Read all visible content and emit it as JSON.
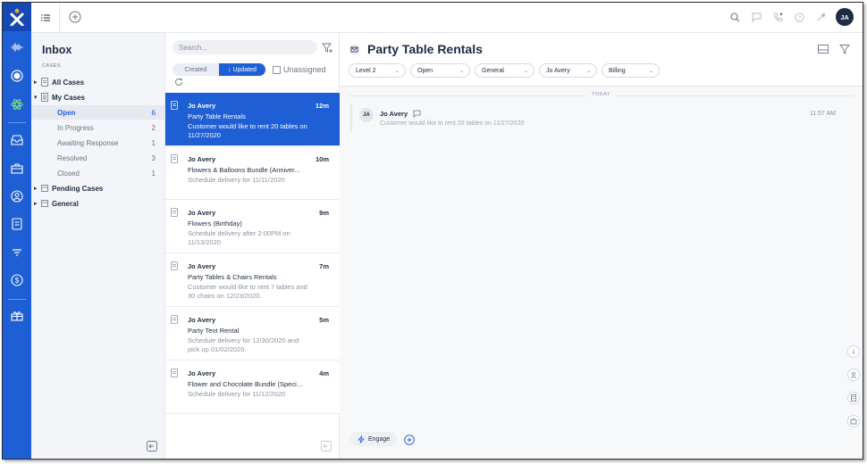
{
  "brand": {
    "accent": "#1f5fd6",
    "rail_dark": "#1548b3",
    "logo_letter": "x"
  },
  "topbar": {
    "icons": [
      "list-icon",
      "add-circle-icon",
      "search-icon",
      "chat-icon",
      "phone-icon",
      "help-icon",
      "tools-icon"
    ],
    "user_initials": "JA"
  },
  "rail": {
    "icons": [
      "waveform-icon",
      "record-icon",
      "atom-icon",
      "inbox-icon",
      "briefcase-icon",
      "contact-icon",
      "document-icon",
      "filter-icon",
      "dollar-icon",
      "gift-icon"
    ]
  },
  "sidebar": {
    "title": "Inbox",
    "caption": "CASES",
    "all_cases": "All Cases",
    "my_cases": "My Cases",
    "sub_items": [
      {
        "label": "Open",
        "count": "6"
      },
      {
        "label": "In Progress",
        "count": "2"
      },
      {
        "label": "Awaiting Response",
        "count": "1"
      },
      {
        "label": "Resolved",
        "count": "3"
      },
      {
        "label": "Closed",
        "count": "1"
      }
    ],
    "pending_cases": "Pending Cases",
    "general": "General"
  },
  "caselist": {
    "search_placeholder": "Search...",
    "tab_created": "Created",
    "tab_updated": "↓ Updated",
    "unassigned": "Unassigned",
    "cases": [
      {
        "who": "Jo Avery",
        "age": "12m",
        "subject": "Party Table Rentals",
        "preview": "Customer would like to rent 20 tables on 11/27/2020",
        "selected": true
      },
      {
        "who": "Jo Avery",
        "age": "10m",
        "subject": "Flowers & Balloons Bundle (Anniver...",
        "preview": "Schedule delivery for 11/11/2020",
        "selected": false
      },
      {
        "who": "Jo Avery",
        "age": "9m",
        "subject": "Flowers (Birthday)",
        "preview": "Schedule delivery after 2:00PM on 11/13/2020",
        "selected": false
      },
      {
        "who": "Jo Avery",
        "age": "7m",
        "subject": "Party Tables & Chairs Rentals",
        "preview": "Customer would like to rent 7 tables and 30 chairs on 12/23/2020.",
        "selected": false
      },
      {
        "who": "Jo Avery",
        "age": "5m",
        "subject": "Party Tent Rental",
        "preview": "Schedule delivery for 12/30/2020 and pick up 01/02/2020.",
        "selected": false
      },
      {
        "who": "Jo Avery",
        "age": "4m",
        "subject": "Flower and Chocolate Bundle (Special...",
        "preview": "Schedule delivery for 11/12/2020",
        "selected": false
      }
    ]
  },
  "detail": {
    "title": "Party Table Rentals",
    "pills": [
      "Level 2",
      "Open",
      "General",
      "Jo Avery",
      "Billing"
    ],
    "today_label": "TODAY",
    "message": {
      "initials": "JA",
      "who": "Jo Avery",
      "text": "Customer would like to rent 20 tables on 11/27/2020",
      "time": "11:57 AM"
    },
    "engage_label": "Engage"
  }
}
